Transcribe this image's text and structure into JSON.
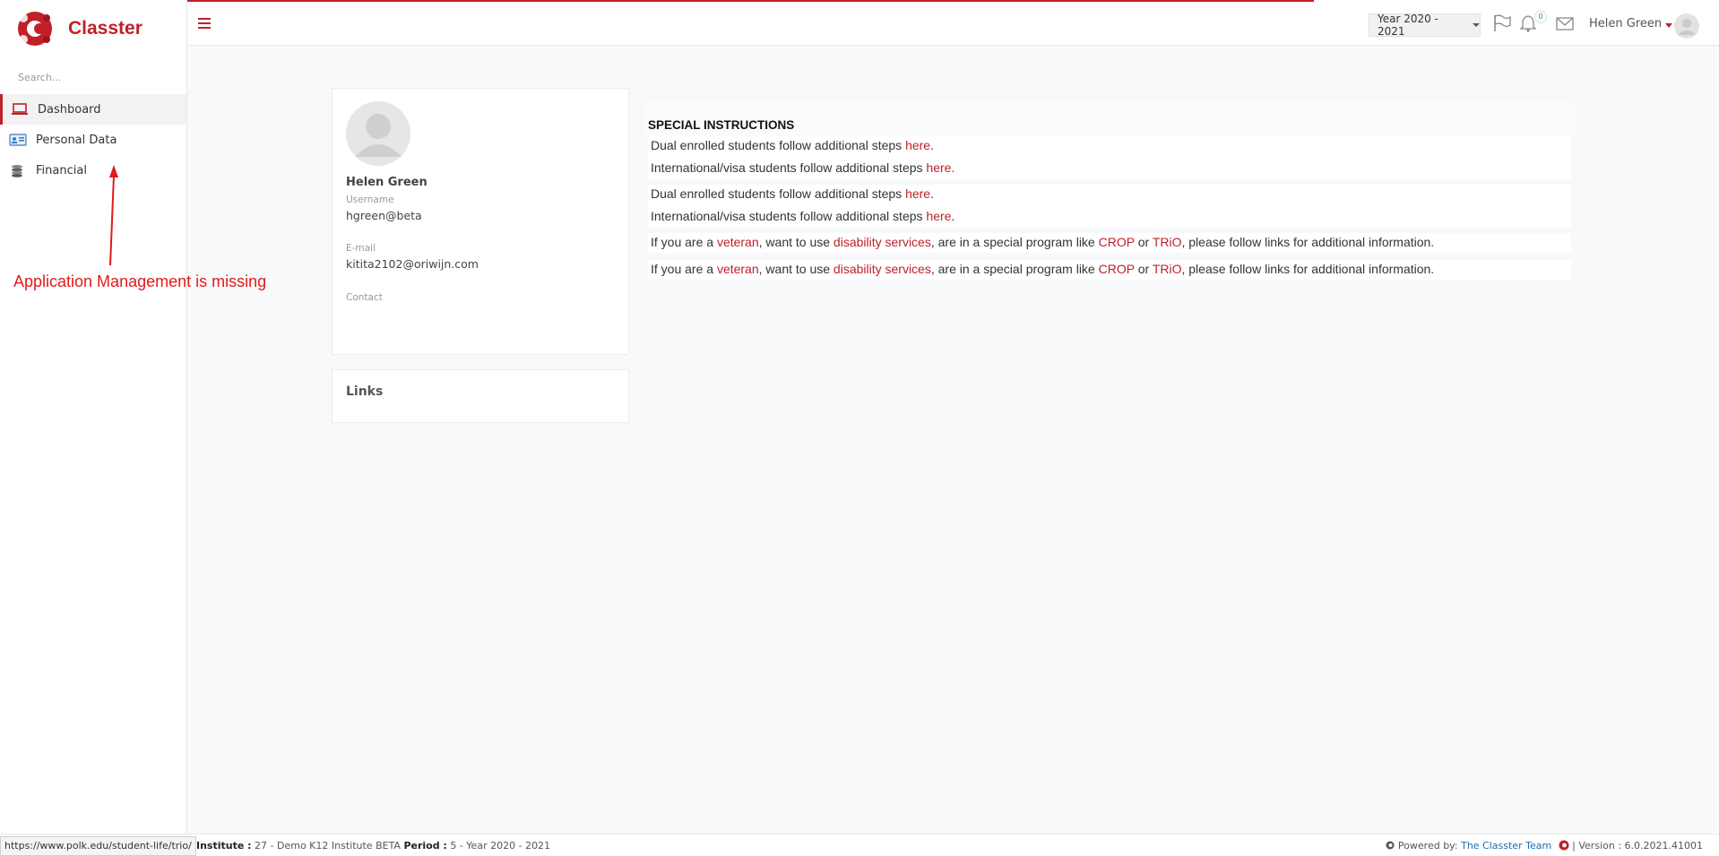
{
  "app": {
    "brand": "Classter",
    "search_placeholder": "Search..."
  },
  "sidebar": {
    "items": [
      {
        "label": "Dashboard",
        "icon": "laptop-icon",
        "active": true
      },
      {
        "label": "Personal Data",
        "icon": "id-card-icon",
        "active": false
      },
      {
        "label": "Financial",
        "icon": "coins-icon",
        "active": false
      }
    ]
  },
  "annotation": {
    "text": "Application Management is missing",
    "color": "#e01b1b"
  },
  "topbar": {
    "year_select": "Year 2020 - 2021",
    "notification_count": "0",
    "user_name": "Helen Green"
  },
  "profile": {
    "name": "Helen Green",
    "username_label": "Username",
    "username": "hgreen@beta",
    "email_label": "E-mail",
    "email": "kitita2102@oriwijn.com",
    "contact_label": "Contact"
  },
  "links": {
    "title": "Links"
  },
  "instructions": {
    "title": "SPECIAL INSTRUCTIONS",
    "line1_text": "Dual enrolled students follow additional steps ",
    "line1_link": "here",
    "line2_text": "International/visa students follow additional steps ",
    "line2_link": "here",
    "line3_text": "Dual enrolled students follow additional steps ",
    "line3_link": "here",
    "line4_text": "International/visa students follow additional steps ",
    "line4_link": "here",
    "vet_prefix": "If you are a ",
    "vet_link": "veteran",
    "vet_mid1": ", want to use ",
    "dis_link": "disability services",
    "vet_mid2": ", are in a special program like ",
    "crop_link": "CROP",
    "vet_or": " or ",
    "trio_link": "TRiO",
    "vet_suffix": ", please follow links for additional information."
  },
  "footer": {
    "status_url": "https://www.polk.edu/student-life/trio/",
    "institute_label": "Institute :",
    "institute_value": " 27 - Demo K12 Institute BETA ",
    "period_label": "Period :",
    "period_value": " 5 - Year 2020 - 2021",
    "powered_by": " Powered by: ",
    "team_link": "The Classter Team",
    "version": " | Version : 6.0.2021.41001"
  },
  "colors": {
    "brand": "#c0202a",
    "link": "#c0202a",
    "footer_link": "#1a6fb5"
  }
}
